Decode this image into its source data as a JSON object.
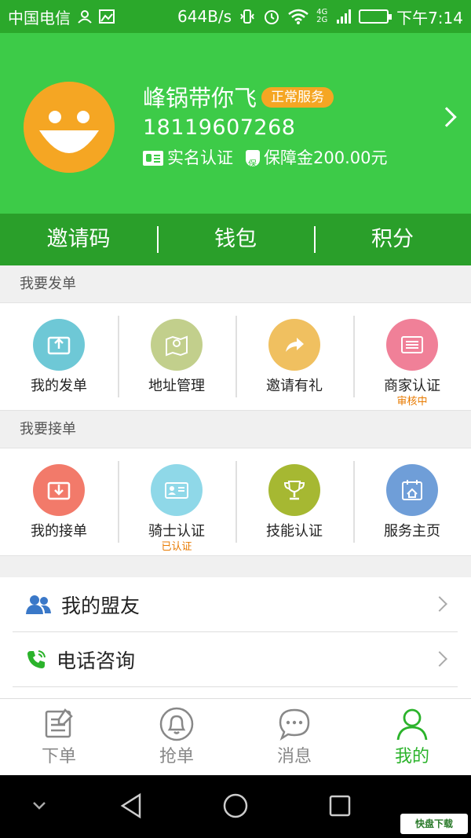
{
  "status_bar": {
    "carrier": "中国电信",
    "speed": "644B/s",
    "network_badge": "4G 2G",
    "time": "下午7:14"
  },
  "profile": {
    "name": "峰锅带你飞",
    "service_badge": "正常服务",
    "phone": "18119607268",
    "realname_label": "实名认证",
    "deposit_label": "保障金200.00元"
  },
  "top_tabs": [
    "邀请码",
    "钱包",
    "积分"
  ],
  "send_section": {
    "title": "我要发单",
    "items": [
      {
        "label": "我的发单",
        "sub": "",
        "icon": "upload-box-icon",
        "color": "#6ec8d6"
      },
      {
        "label": "地址管理",
        "sub": "",
        "icon": "map-pin-icon",
        "color": "#c2cf8c"
      },
      {
        "label": "邀请有礼",
        "sub": "",
        "icon": "share-arrow-icon",
        "color": "#f0c060"
      },
      {
        "label": "商家认证",
        "sub": "审核中",
        "icon": "list-card-icon",
        "color": "#f08098"
      }
    ]
  },
  "receive_section": {
    "title": "我要接单",
    "items": [
      {
        "label": "我的接单",
        "sub": "",
        "icon": "download-box-icon",
        "color": "#f27a6a"
      },
      {
        "label": "骑士认证",
        "sub": "已认证",
        "icon": "id-card-icon",
        "color": "#8fd8e8"
      },
      {
        "label": "技能认证",
        "sub": "",
        "icon": "trophy-icon",
        "color": "#a6b832"
      },
      {
        "label": "服务主页",
        "sub": "",
        "icon": "home-calendar-icon",
        "color": "#6f9ed8"
      }
    ]
  },
  "list": [
    {
      "label": "我的盟友",
      "icon": "allies-icon"
    },
    {
      "label": "电话咨询",
      "icon": "phone-icon"
    }
  ],
  "bottom_nav": [
    {
      "label": "下单",
      "icon": "edit-note-icon",
      "active": false
    },
    {
      "label": "抢单",
      "icon": "bell-icon",
      "active": false
    },
    {
      "label": "消息",
      "icon": "chat-bubble-icon",
      "active": false
    },
    {
      "label": "我的",
      "icon": "user-icon",
      "active": true
    }
  ],
  "colors": {
    "header_green": "#3dcb48",
    "tabs_green": "#2a9f2a",
    "active_green": "#2bb32b",
    "badge_orange": "#f5a623"
  }
}
